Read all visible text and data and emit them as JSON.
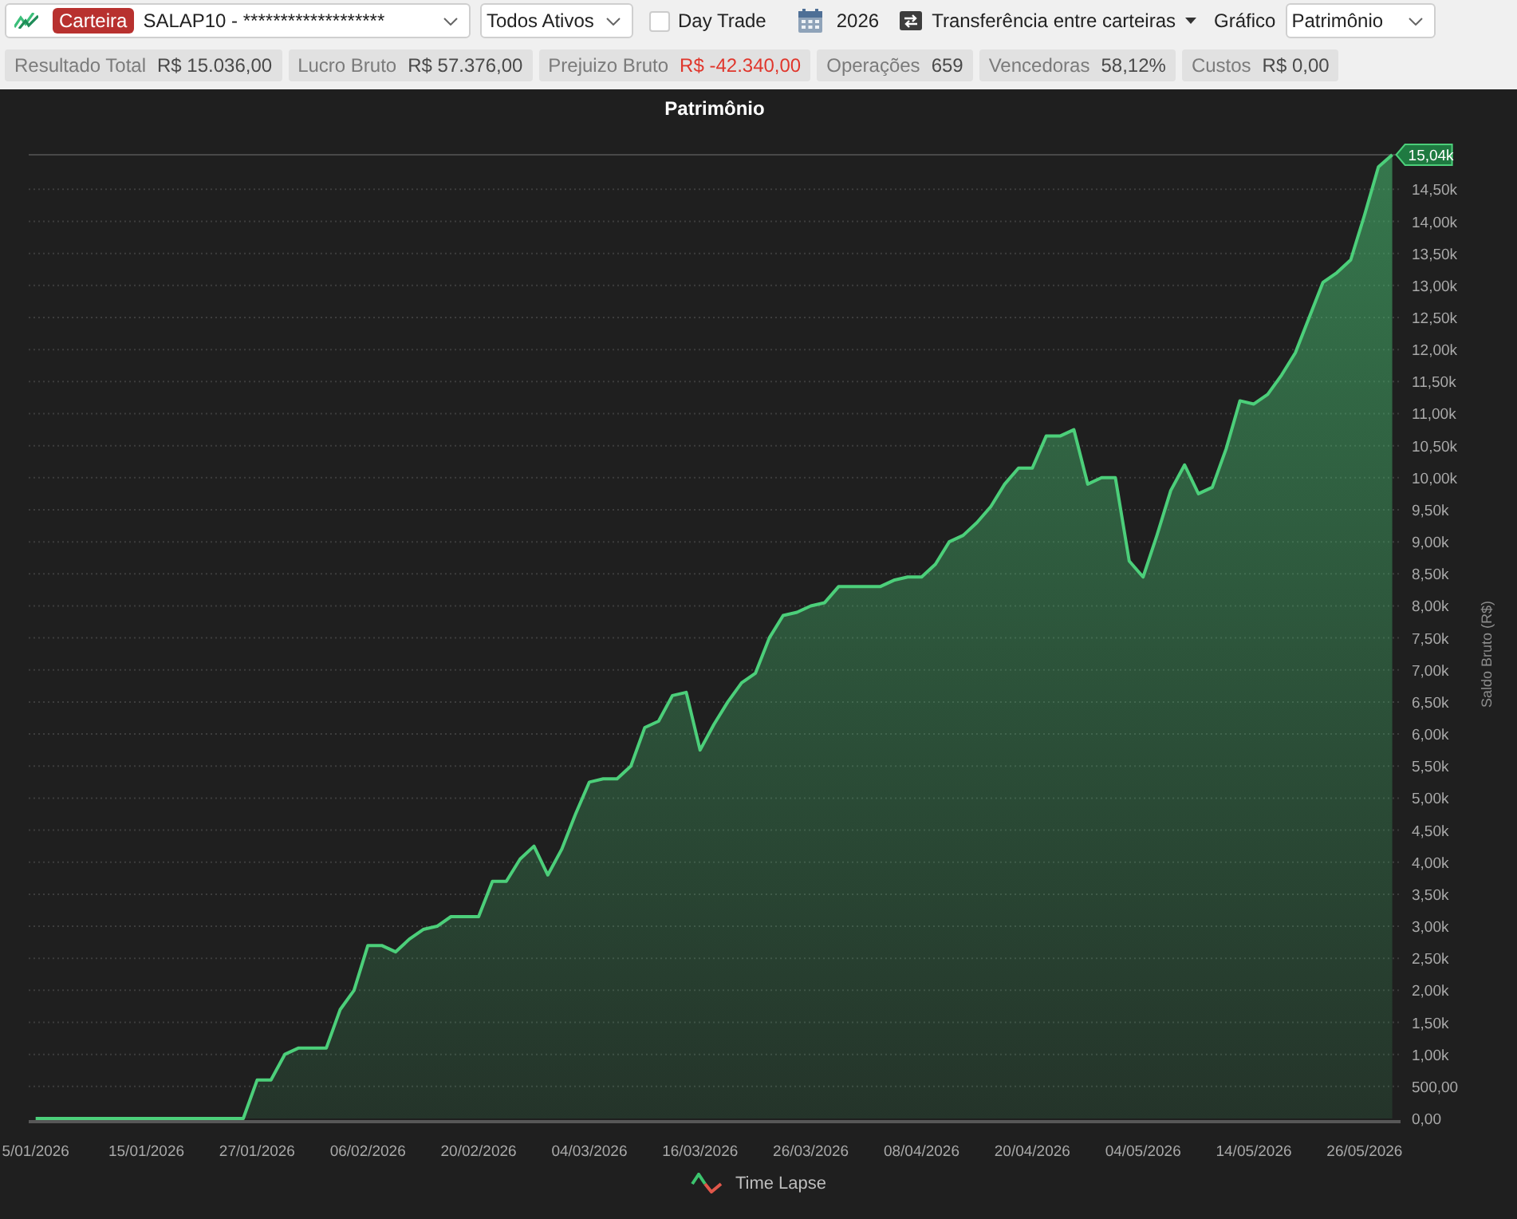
{
  "toolbar": {
    "portfolio_select": {
      "badge": "Carteira",
      "value": "SALAP10 - *******************"
    },
    "asset_select": {
      "value": "Todos Ativos"
    },
    "day_trade": {
      "label": "Day Trade",
      "checked": false
    },
    "year": "2026",
    "transfer_menu": "Transferência entre carteiras",
    "chart_type": {
      "label": "Gráfico",
      "value": "Patrimônio"
    }
  },
  "stats": [
    {
      "label": "Resultado Total",
      "value": "R$ 15.036,00",
      "color": "#4a4a4a"
    },
    {
      "label": "Lucro Bruto",
      "value": "R$ 57.376,00",
      "color": "#4a4a4a"
    },
    {
      "label": "Prejuizo Bruto",
      "value": "R$ -42.340,00",
      "color": "#e0362c"
    },
    {
      "label": "Operações",
      "value": "659",
      "color": "#4a4a4a"
    },
    {
      "label": "Vencedoras",
      "value": "58,12%",
      "color": "#4a4a4a"
    },
    {
      "label": "Custos",
      "value": "R$ 0,00",
      "color": "#4a4a4a"
    }
  ],
  "chart": {
    "chart_data": {
      "type": "area",
      "title": "Patrimônio",
      "ylabel": "Saldo Bruto (R$)",
      "grid": true,
      "categories": [
        "5/01/2026",
        null,
        null,
        null,
        null,
        null,
        null,
        null,
        "15/01/2026",
        null,
        null,
        null,
        null,
        null,
        null,
        null,
        "27/01/2026",
        null,
        null,
        null,
        null,
        null,
        null,
        null,
        "06/02/2026",
        null,
        null,
        null,
        null,
        null,
        null,
        null,
        "20/02/2026",
        null,
        null,
        null,
        null,
        null,
        null,
        null,
        "04/03/2026",
        null,
        null,
        null,
        null,
        null,
        null,
        null,
        "16/03/2026",
        null,
        null,
        null,
        null,
        null,
        null,
        null,
        "26/03/2026",
        null,
        null,
        null,
        null,
        null,
        null,
        null,
        "08/04/2026",
        null,
        null,
        null,
        null,
        null,
        null,
        null,
        "20/04/2026",
        null,
        null,
        null,
        null,
        null,
        null,
        null,
        "04/05/2026",
        null,
        null,
        null,
        null,
        null,
        null,
        null,
        "14/05/2026",
        null,
        null,
        null,
        null,
        null,
        null,
        null,
        "26/05/2026",
        null,
        null
      ],
      "series": [
        {
          "name": "Time Lapse",
          "color": "#4ccf7a",
          "values": [
            0,
            0,
            0,
            0,
            0,
            0,
            0,
            0,
            0,
            0,
            0,
            0,
            0,
            0,
            0,
            0,
            600,
            600,
            1000,
            1100,
            1100,
            1100,
            1700,
            2000,
            2700,
            2700,
            2600,
            2800,
            2950,
            3000,
            3150,
            3150,
            3150,
            3700,
            3700,
            4050,
            4250,
            3800,
            4200,
            4750,
            5250,
            5300,
            5300,
            5500,
            6100,
            6200,
            6600,
            6650,
            5750,
            6150,
            6500,
            6800,
            6950,
            7500,
            7850,
            7900,
            8000,
            8050,
            8300,
            8300,
            8300,
            8300,
            8400,
            8450,
            8450,
            8650,
            9000,
            9100,
            9300,
            9550,
            9900,
            10150,
            10150,
            10650,
            10650,
            10750,
            9900,
            10000,
            10000,
            8700,
            8450,
            9100,
            9800,
            10200,
            9750,
            9850,
            10450,
            11200,
            11150,
            11300,
            11600,
            11950,
            12500,
            13050,
            13200,
            13400,
            14100,
            14850,
            15040
          ]
        }
      ],
      "ylim": [
        0,
        15040
      ],
      "yticks": [
        {
          "value": 0,
          "label": "0,00"
        },
        {
          "value": 500,
          "label": "500,00"
        },
        {
          "value": 1000,
          "label": "1,00k"
        },
        {
          "value": 1500,
          "label": "1,50k"
        },
        {
          "value": 2000,
          "label": "2,00k"
        },
        {
          "value": 2500,
          "label": "2,50k"
        },
        {
          "value": 3000,
          "label": "3,00k"
        },
        {
          "value": 3500,
          "label": "3,50k"
        },
        {
          "value": 4000,
          "label": "4,00k"
        },
        {
          "value": 4500,
          "label": "4,50k"
        },
        {
          "value": 5000,
          "label": "5,00k"
        },
        {
          "value": 5500,
          "label": "5,50k"
        },
        {
          "value": 6000,
          "label": "6,00k"
        },
        {
          "value": 6500,
          "label": "6,50k"
        },
        {
          "value": 7000,
          "label": "7,00k"
        },
        {
          "value": 7500,
          "label": "7,50k"
        },
        {
          "value": 8000,
          "label": "8,00k"
        },
        {
          "value": 8500,
          "label": "8,50k"
        },
        {
          "value": 9000,
          "label": "9,00k"
        },
        {
          "value": 9500,
          "label": "9,50k"
        },
        {
          "value": 10000,
          "label": "10,00k"
        },
        {
          "value": 10500,
          "label": "10,50k"
        },
        {
          "value": 11000,
          "label": "11,00k"
        },
        {
          "value": 11500,
          "label": "11,50k"
        },
        {
          "value": 12000,
          "label": "12,00k"
        },
        {
          "value": 12500,
          "label": "12,50k"
        },
        {
          "value": 13000,
          "label": "13,00k"
        },
        {
          "value": 13500,
          "label": "13,50k"
        },
        {
          "value": 14000,
          "label": "14,00k"
        },
        {
          "value": 14500,
          "label": "14,50k"
        }
      ],
      "annotations": [
        "15,04k"
      ]
    }
  }
}
